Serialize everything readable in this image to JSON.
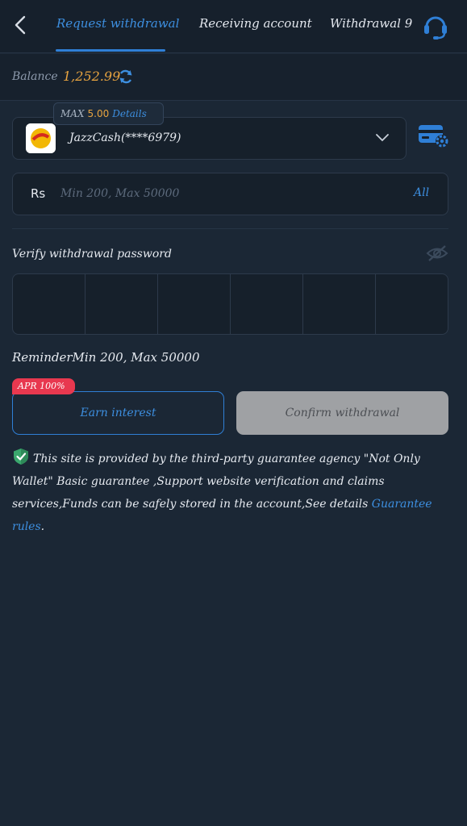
{
  "header": {
    "tabs": [
      {
        "label": "Request withdrawal",
        "active": true
      },
      {
        "label": "Receiving account",
        "active": false
      },
      {
        "label": "Withdrawal 9",
        "active": false
      }
    ],
    "icons": {
      "back": "chevron-left-icon",
      "support": "headset-icon"
    }
  },
  "balance": {
    "label": "Balance",
    "value": "1,252.99",
    "value_color": "#e8a440"
  },
  "account": {
    "max_label": "MAX",
    "max_value": "5.00",
    "details_label": "Details",
    "name": "JazzCash(****6979)"
  },
  "amount": {
    "currency": "Rs",
    "placeholder": "Min 200, Max 50000",
    "all_label": "All"
  },
  "password": {
    "label": "Verify withdrawal password",
    "digit_count": 6
  },
  "reminder": "ReminderMin 200, Max 50000",
  "actions": {
    "apr_badge": "APR 100%",
    "earn_label": "Earn interest",
    "confirm_label": "Confirm withdrawal"
  },
  "notice": {
    "text": "This site is provided by the third-party guarantee agency \"Not Only Wallet\" Basic guarantee ,Support website verification and claims services,Funds can be safely stored in the account,See details ",
    "link": "Guarantee rules",
    "end": "."
  },
  "colors": {
    "accent": "#3d8fe0",
    "background": "#1b2735",
    "badge": "#e8384f"
  }
}
